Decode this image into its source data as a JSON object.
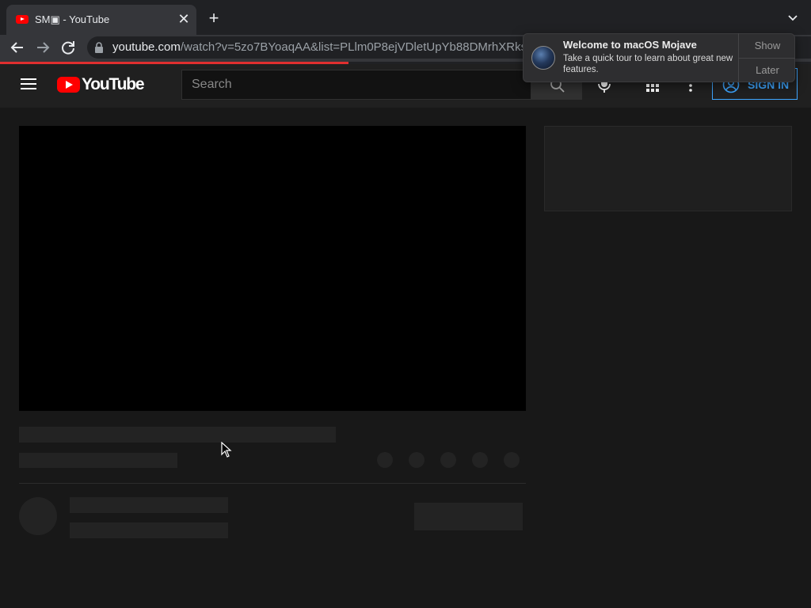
{
  "browser": {
    "tab": {
      "title": "SM▣ - YouTube",
      "close_glyph": "✕"
    },
    "new_tab_glyph": "+",
    "url": {
      "host": "youtube.com",
      "path": "/watch?v=5zo7BYoaqAA&list=PLlm0P8ejVDletUpYb88DMrhXRksY3"
    },
    "load_progress_percent": 43
  },
  "youtube": {
    "logo_text": "YouTube",
    "search": {
      "placeholder": "Search",
      "value": ""
    },
    "sign_in_label": "SIGN IN",
    "brand_color": "#ff0000",
    "accent_color": "#3ea6ff"
  },
  "notification": {
    "title": "Welcome to macOS Mojave",
    "body": "Take a quick tour to learn about great new features.",
    "show_label": "Show",
    "later_label": "Later"
  },
  "icons": [
    "back-icon",
    "forward-icon",
    "reload-icon",
    "lock-icon",
    "hamburger-icon",
    "search-icon",
    "mic-icon",
    "apps-icon",
    "more-icon",
    "account-icon",
    "tab-list-icon",
    "cursor-icon"
  ]
}
